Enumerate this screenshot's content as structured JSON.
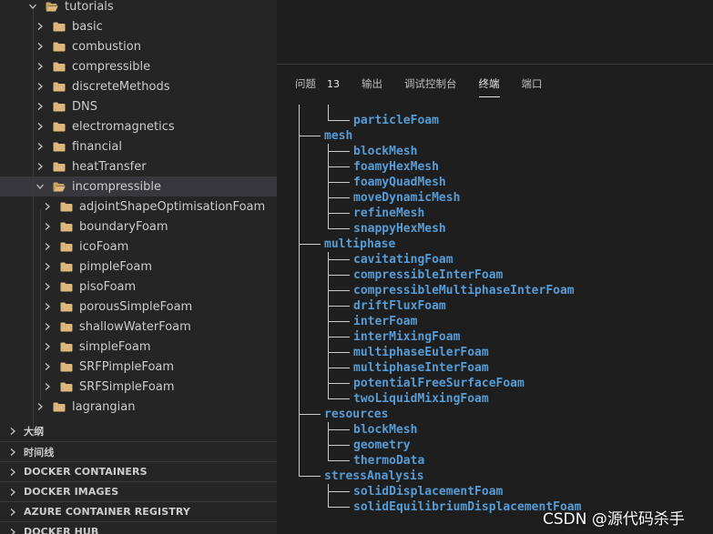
{
  "explorer": {
    "tree": [
      {
        "label": "tutorials",
        "expanded": true
      },
      {
        "label": "basic",
        "expanded": false
      },
      {
        "label": "combustion",
        "expanded": false
      },
      {
        "label": "compressible",
        "expanded": false
      },
      {
        "label": "discreteMethods",
        "expanded": false
      },
      {
        "label": "DNS",
        "expanded": false
      },
      {
        "label": "electromagnetics",
        "expanded": false
      },
      {
        "label": "financial",
        "expanded": false
      },
      {
        "label": "heatTransfer",
        "expanded": false
      },
      {
        "label": "incompressible",
        "expanded": true,
        "selected": true
      },
      {
        "label": "adjointShapeOptimisationFoam",
        "expanded": false
      },
      {
        "label": "boundaryFoam",
        "expanded": false
      },
      {
        "label": "icoFoam",
        "expanded": false
      },
      {
        "label": "pimpleFoam",
        "expanded": false
      },
      {
        "label": "pisoFoam",
        "expanded": false
      },
      {
        "label": "porousSimpleFoam",
        "expanded": false
      },
      {
        "label": "shallowWaterFoam",
        "expanded": false
      },
      {
        "label": "simpleFoam",
        "expanded": false
      },
      {
        "label": "SRFPimpleFoam",
        "expanded": false
      },
      {
        "label": "SRFSimpleFoam",
        "expanded": false
      },
      {
        "label": "lagrangian",
        "expanded": false
      }
    ],
    "sections": [
      {
        "label": "大纲"
      },
      {
        "label": "时间线"
      },
      {
        "label": "DOCKER CONTAINERS"
      },
      {
        "label": "DOCKER IMAGES"
      },
      {
        "label": "AZURE CONTAINER REGISTRY"
      },
      {
        "label": "DOCKER HUB"
      }
    ]
  },
  "panel": {
    "tabs": [
      {
        "label": "问题",
        "badge": "13"
      },
      {
        "label": "输出"
      },
      {
        "label": "调试控制台"
      },
      {
        "label": "终端",
        "active": true
      },
      {
        "label": "端口"
      }
    ],
    "terminal": {
      "lines": [
        {
          "text": "particleFoam",
          "level": 2
        },
        {
          "text": "mesh",
          "level": 1
        },
        {
          "text": "blockMesh",
          "level": 2
        },
        {
          "text": "foamyHexMesh",
          "level": 2
        },
        {
          "text": "foamyQuadMesh",
          "level": 2
        },
        {
          "text": "moveDynamicMesh",
          "level": 2
        },
        {
          "text": "refineMesh",
          "level": 2
        },
        {
          "text": "snappyHexMesh",
          "level": 2
        },
        {
          "text": "multiphase",
          "level": 1
        },
        {
          "text": "cavitatingFoam",
          "level": 2
        },
        {
          "text": "compressibleInterFoam",
          "level": 2
        },
        {
          "text": "compressibleMultiphaseInterFoam",
          "level": 2
        },
        {
          "text": "driftFluxFoam",
          "level": 2
        },
        {
          "text": "interFoam",
          "level": 2
        },
        {
          "text": "interMixingFoam",
          "level": 2
        },
        {
          "text": "multiphaseEulerFoam",
          "level": 2
        },
        {
          "text": "multiphaseInterFoam",
          "level": 2
        },
        {
          "text": "potentialFreeSurfaceFoam",
          "level": 2
        },
        {
          "text": "twoLiquidMixingFoam",
          "level": 2
        },
        {
          "text": "resources",
          "level": 1
        },
        {
          "text": "blockMesh",
          "level": 2
        },
        {
          "text": "geometry",
          "level": 2
        },
        {
          "text": "thermoData",
          "level": 2
        },
        {
          "text": "stressAnalysis",
          "level": 1
        },
        {
          "text": "solidDisplacementFoam",
          "level": 2
        },
        {
          "text": "solidEquilibriumDisplacementFoam",
          "level": 2
        }
      ]
    }
  },
  "watermark": "CSDN @源代码杀手",
  "colors": {
    "sidebar_bg": "#252526",
    "editor_bg": "#1e1e1e",
    "folder": "#dcb67a",
    "terminal_blue": "#569cd6",
    "selected_row": "#37373d"
  }
}
